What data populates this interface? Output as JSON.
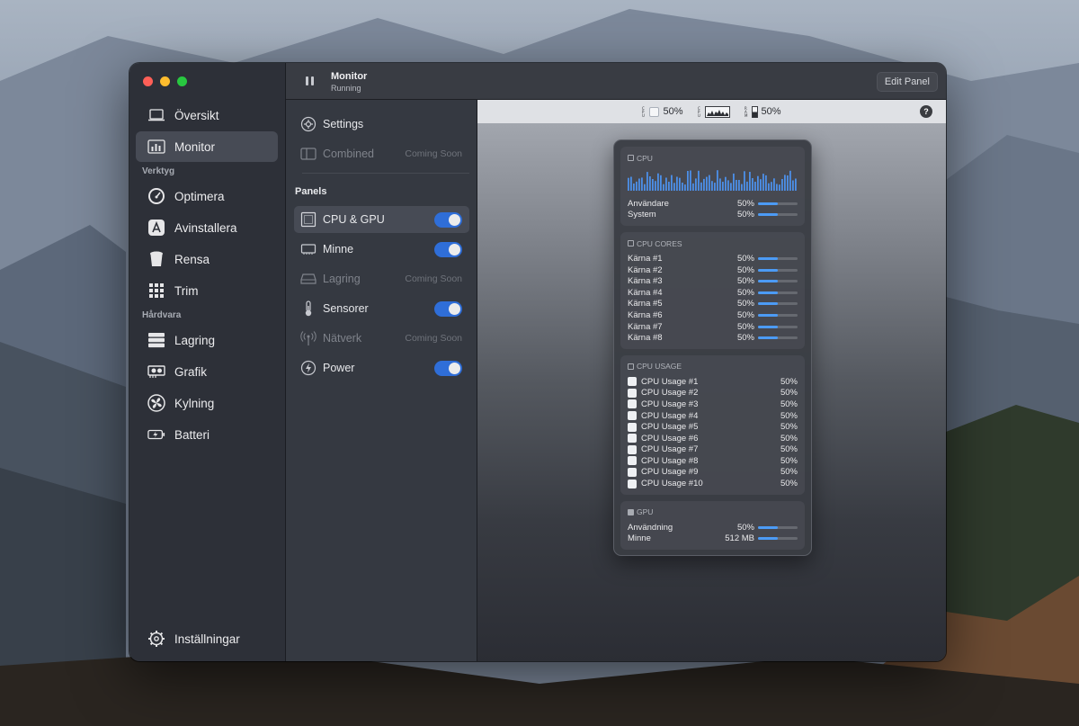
{
  "sidebar": {
    "items": [
      {
        "label": "Översikt",
        "icon": "laptop-icon"
      },
      {
        "label": "Monitor",
        "icon": "chart-bars-icon",
        "active": true
      }
    ],
    "section_tools": "Verktyg",
    "tools": [
      {
        "label": "Optimera",
        "icon": "gauge-icon"
      },
      {
        "label": "Avinstallera",
        "icon": "app-store-icon"
      },
      {
        "label": "Rensa",
        "icon": "bin-icon"
      },
      {
        "label": "Trim",
        "icon": "grid-icon"
      }
    ],
    "section_hardware": "Hårdvara",
    "hardware": [
      {
        "label": "Lagring",
        "icon": "server-icon"
      },
      {
        "label": "Grafik",
        "icon": "gpu-icon"
      },
      {
        "label": "Kylning",
        "icon": "fan-icon"
      },
      {
        "label": "Batteri",
        "icon": "battery-icon"
      }
    ],
    "settings_label": "Inställningar"
  },
  "titlebar": {
    "title": "Monitor",
    "subtitle": "Running",
    "edit_label": "Edit Panel"
  },
  "middle": {
    "settings_label": "Settings",
    "combined_label": "Combined",
    "coming_soon": "Coming Soon",
    "panels_header": "Panels",
    "panels": [
      {
        "label": "CPU & GPU",
        "enabled": true,
        "active": true
      },
      {
        "label": "Minne",
        "enabled": true
      },
      {
        "label": "Lagring",
        "enabled": false,
        "soon": true
      },
      {
        "label": "Sensorer",
        "enabled": true
      },
      {
        "label": "Nätverk",
        "enabled": false,
        "soon": true
      },
      {
        "label": "Power",
        "enabled": true
      }
    ]
  },
  "menubar": {
    "item1": "50%",
    "item3": "50%",
    "help": "?"
  },
  "popup": {
    "cpu": {
      "title": "CPU",
      "rows": [
        {
          "label": "Användare",
          "value": "50%",
          "level": 0.5
        },
        {
          "label": "System",
          "value": "50%",
          "level": 0.5
        }
      ]
    },
    "cores": {
      "title": "CPU CORES",
      "rows": [
        {
          "label": "Kärna #1",
          "value": "50%",
          "level": 0.5
        },
        {
          "label": "Kärna #2",
          "value": "50%",
          "level": 0.5
        },
        {
          "label": "Kärna #3",
          "value": "50%",
          "level": 0.5
        },
        {
          "label": "Kärna #4",
          "value": "50%",
          "level": 0.5
        },
        {
          "label": "Kärna #5",
          "value": "50%",
          "level": 0.5
        },
        {
          "label": "Kärna #6",
          "value": "50%",
          "level": 0.5
        },
        {
          "label": "Kärna #7",
          "value": "50%",
          "level": 0.5
        },
        {
          "label": "Kärna #8",
          "value": "50%",
          "level": 0.5
        }
      ]
    },
    "usage": {
      "title": "CPU USAGE",
      "rows": [
        {
          "label": "CPU Usage #1",
          "value": "50%"
        },
        {
          "label": "CPU Usage #2",
          "value": "50%"
        },
        {
          "label": "CPU Usage #3",
          "value": "50%"
        },
        {
          "label": "CPU Usage #4",
          "value": "50%"
        },
        {
          "label": "CPU Usage #5",
          "value": "50%"
        },
        {
          "label": "CPU Usage #6",
          "value": "50%"
        },
        {
          "label": "CPU Usage #7",
          "value": "50%"
        },
        {
          "label": "CPU Usage #8",
          "value": "50%"
        },
        {
          "label": "CPU Usage #9",
          "value": "50%"
        },
        {
          "label": "CPU Usage #10",
          "value": "50%"
        }
      ]
    },
    "gpu": {
      "title": "GPU",
      "rows": [
        {
          "label": "Användning",
          "value": "50%",
          "level": 0.5
        },
        {
          "label": "Minne",
          "value": "512 MB",
          "level": 0.5
        }
      ]
    }
  },
  "colors": {
    "accent": "#2f6ed8",
    "bar_fill": "#4c9bf5",
    "graph": "#4c8fe8"
  }
}
